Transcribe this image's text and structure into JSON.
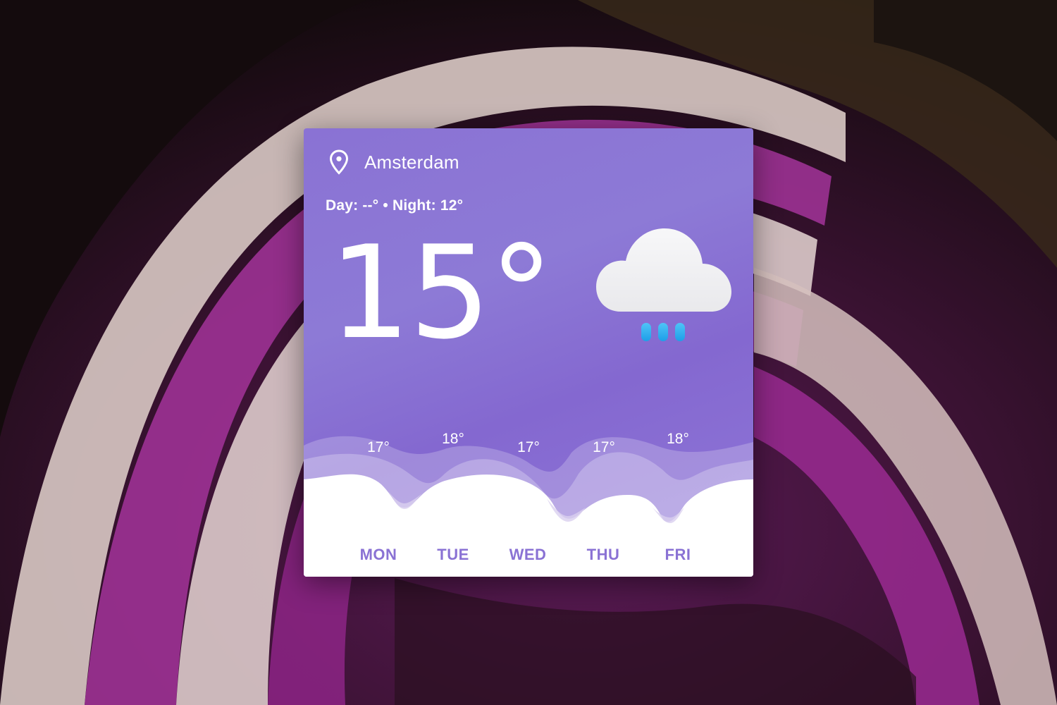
{
  "widget": {
    "city": "Amsterdam",
    "day_night": "Day: --° • Night: 12°",
    "current_temp": "15°",
    "condition_icon": "rain-cloud-icon",
    "location_icon": "location-pin-icon"
  },
  "forecast": [
    {
      "day": "MON",
      "temp": "17°"
    },
    {
      "day": "TUE",
      "temp": "18°"
    },
    {
      "day": "WED",
      "temp": "17°"
    },
    {
      "day": "THU",
      "temp": "17°"
    },
    {
      "day": "FRI",
      "temp": "18°"
    }
  ],
  "colors": {
    "card_accent": "#8a72d4",
    "rain_drop": "#29b6f6",
    "cloud": "#f1f1f3",
    "day_label": "#8a72d4"
  }
}
